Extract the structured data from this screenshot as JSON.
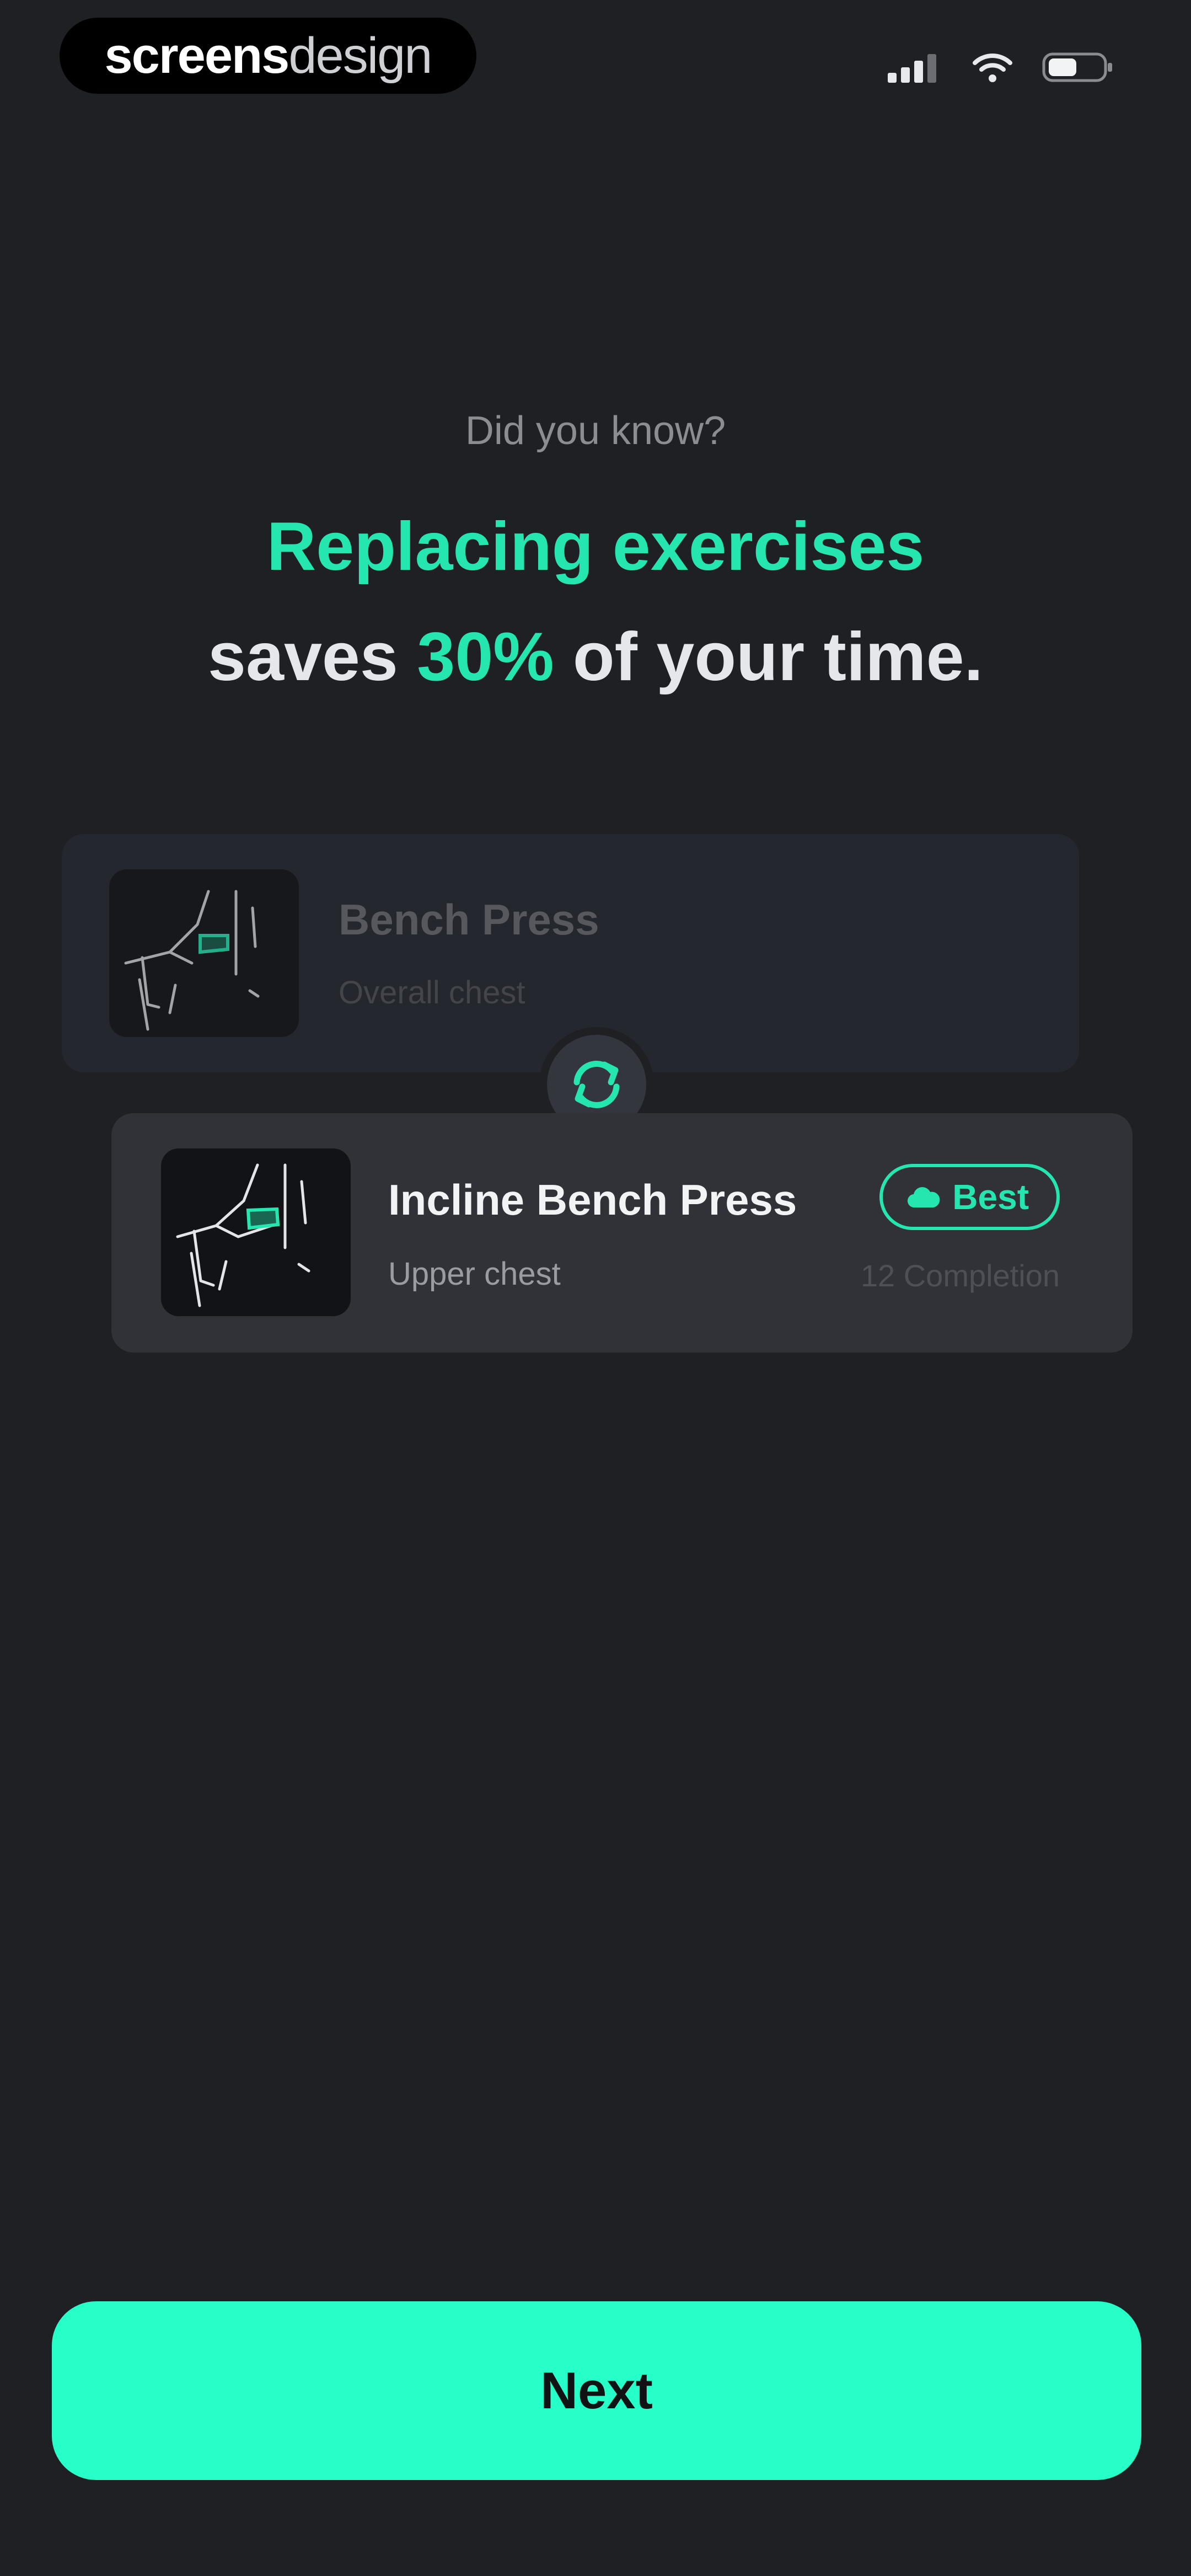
{
  "status_bar": {
    "brand_bold": "screens",
    "brand_light": "design",
    "icons": [
      "signal-icon",
      "wifi-icon",
      "battery-icon"
    ]
  },
  "intro": {
    "eyebrow": "Did you know?",
    "headline_line1": "Replacing exercises",
    "headline_line2_prefix": "saves ",
    "headline_line2_highlight": "30%",
    "headline_line2_suffix": " of your time."
  },
  "exercises": {
    "original": {
      "name": "Bench Press",
      "muscle": "Overall chest",
      "icon": "bench-press-illustration"
    },
    "replacement": {
      "name": "Incline Bench Press",
      "muscle": "Upper chest",
      "badge_label": "Best",
      "badge_icon": "cloud-icon",
      "completions": "12 Completion",
      "icon": "incline-bench-press-illustration"
    },
    "swap_icon": "swap-icon"
  },
  "footer": {
    "next_label": "Next"
  },
  "colors": {
    "background": "#1f2024",
    "accent": "#26e6b0",
    "button": "#26ffc7",
    "card_old": "#262830",
    "card_new": "#303238"
  }
}
